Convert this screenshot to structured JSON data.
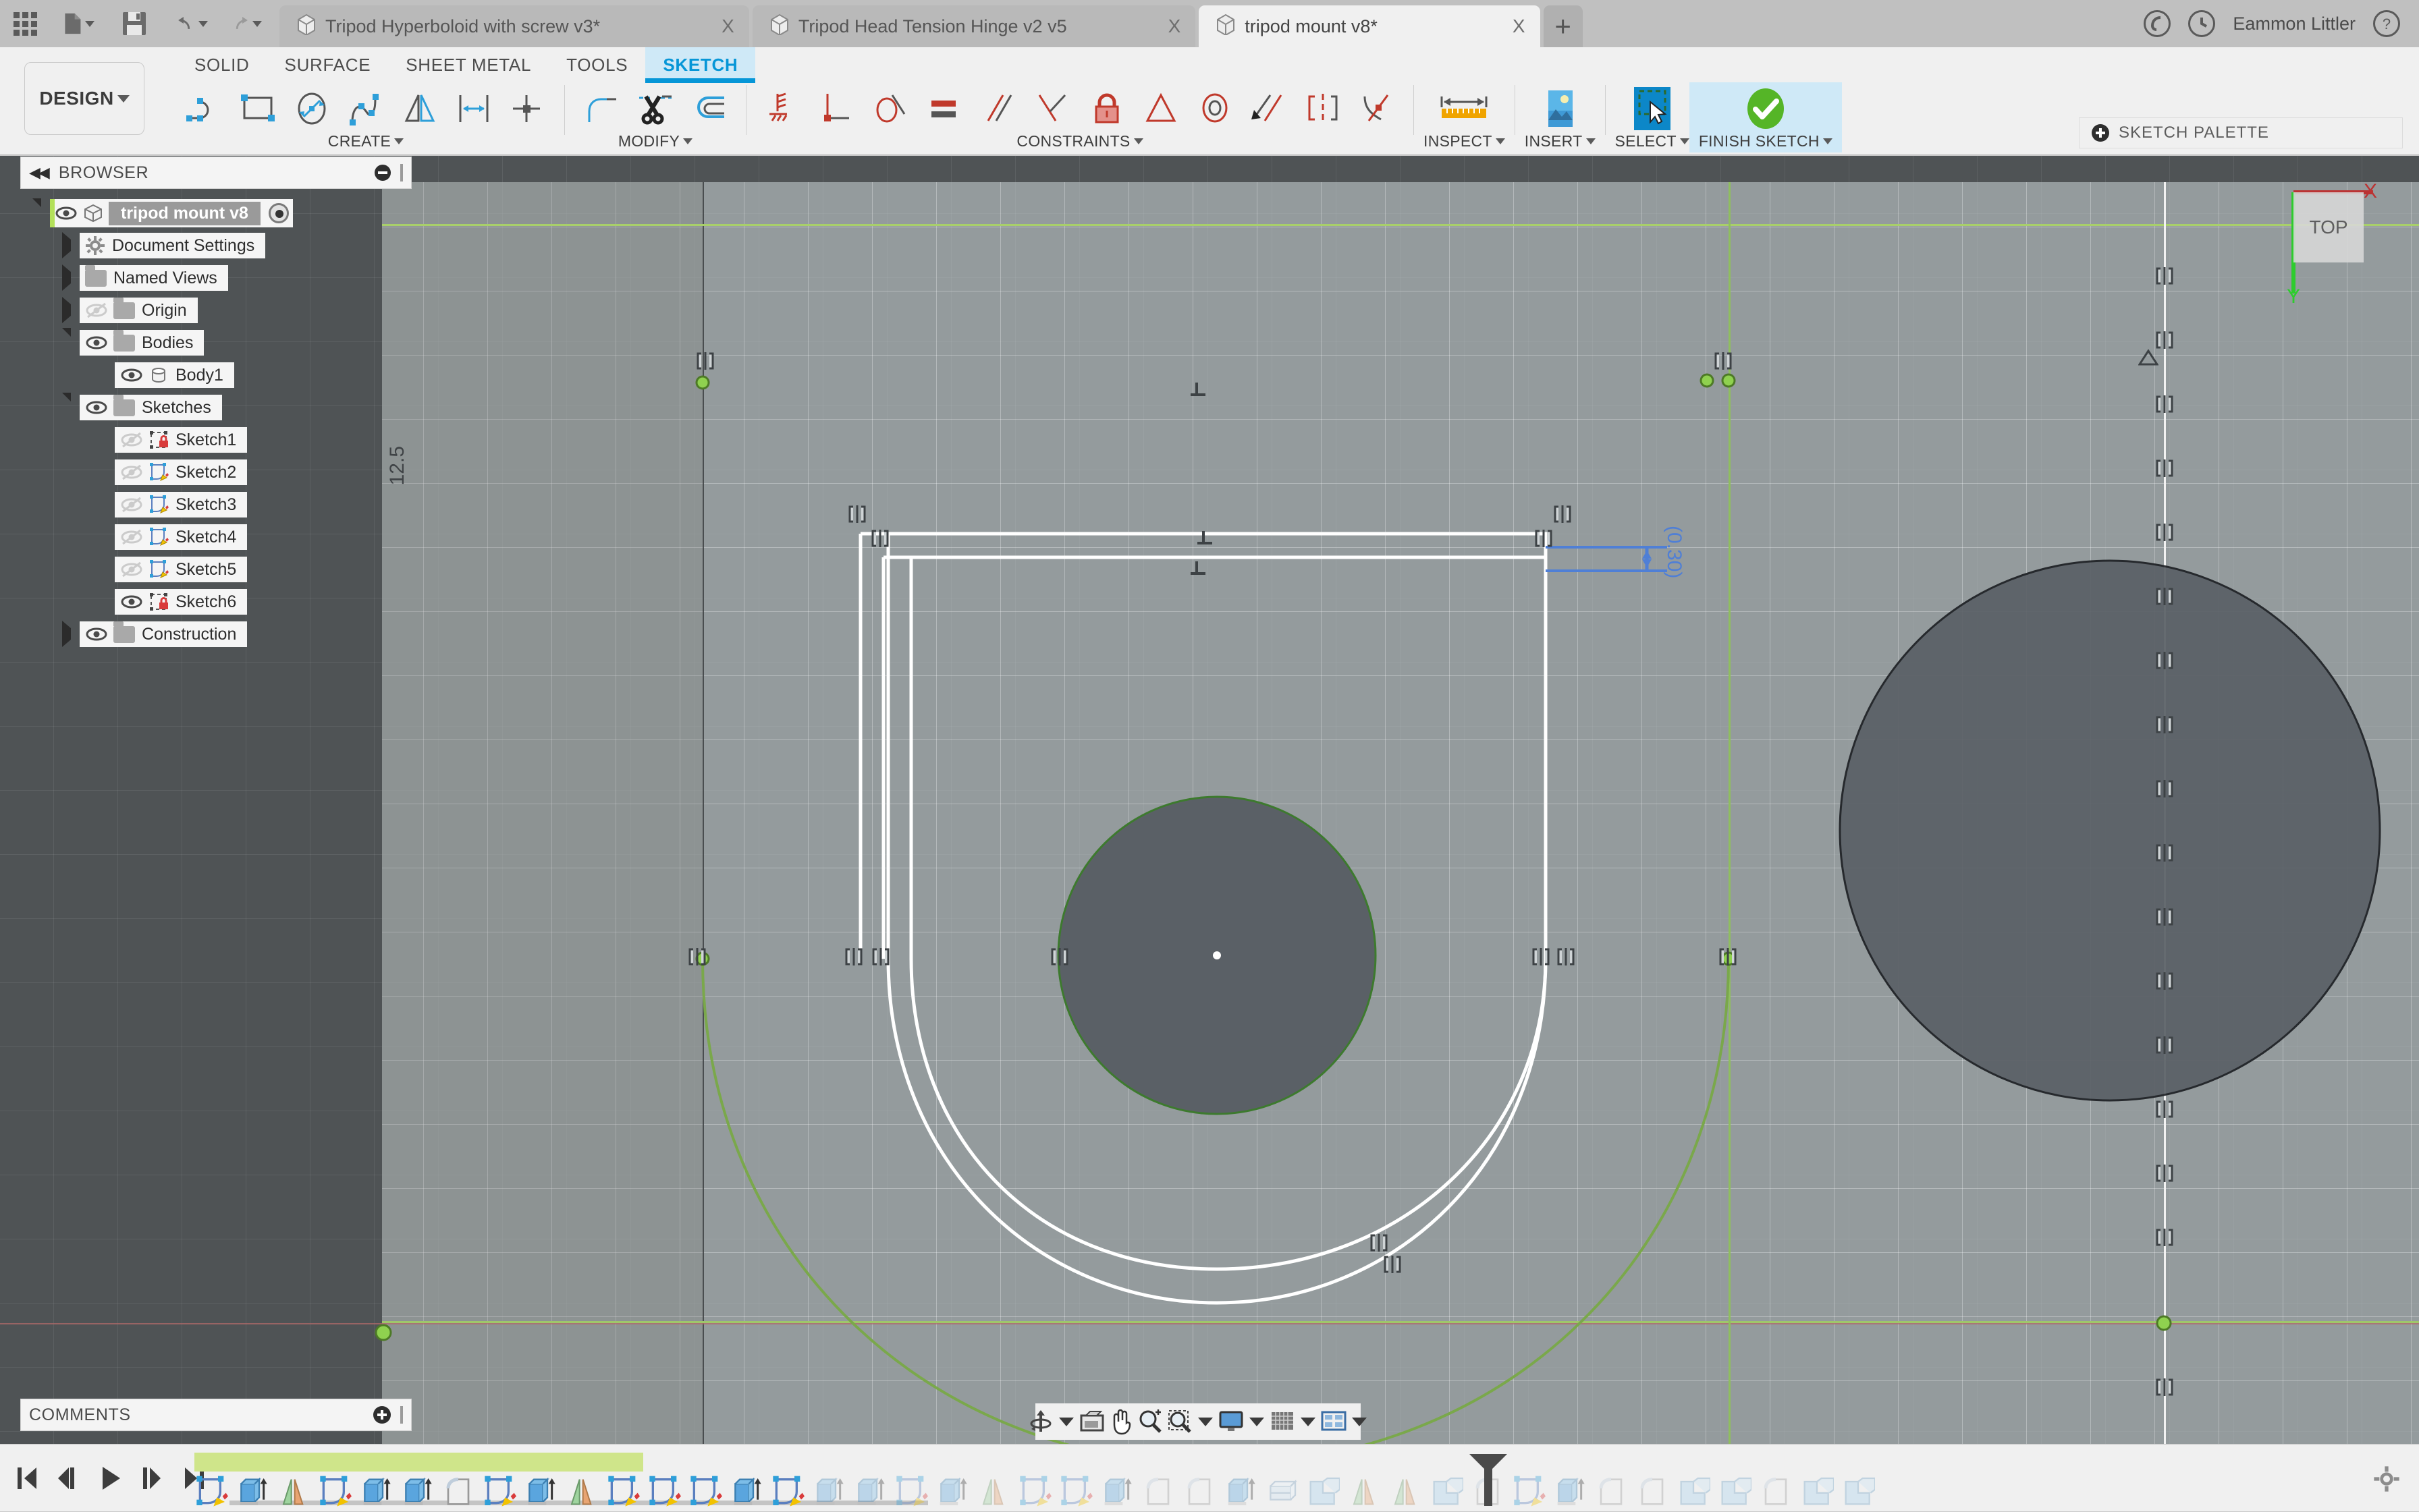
{
  "app": {
    "titlebar_icons": [
      "apps-grid-icon",
      "new-document-icon",
      "save-icon",
      "undo-icon",
      "redo-icon"
    ],
    "username": "Eammon Littler",
    "right_icons": [
      "job-status-icon",
      "recent-activity-icon",
      "help-icon"
    ],
    "new_tab_label": "+",
    "close_label": "X"
  },
  "tabs": [
    {
      "label": "Tripod Hyperboloid with screw v3*",
      "active": false
    },
    {
      "label": "Tripod Head Tension Hinge v2 v5",
      "active": false
    },
    {
      "label": "tripod mount v8*",
      "active": true
    }
  ],
  "ribbon": {
    "design_label": "DESIGN",
    "workspace_tabs": [
      {
        "label": "SOLID",
        "active": false
      },
      {
        "label": "SURFACE",
        "active": false
      },
      {
        "label": "SHEET METAL",
        "active": false
      },
      {
        "label": "TOOLS",
        "active": false
      },
      {
        "label": "SKETCH",
        "active": true
      }
    ],
    "groups": [
      {
        "label": "CREATE",
        "tools": [
          "line-icon",
          "rectangle-icon",
          "circle-icon",
          "spline-icon",
          "mirror-icon",
          "offset-dimension-icon",
          "point-icon"
        ]
      },
      {
        "label": "MODIFY",
        "tools": [
          "fillet-icon",
          "trim-scissors-icon",
          "offset-icon"
        ]
      },
      {
        "label": "CONSTRAINTS",
        "tools": [
          "horizontal-vertical-icon",
          "perpendicular-icon",
          "tangent-icon",
          "equal-icon",
          "parallel-icon",
          "collinear-icon",
          "fix-lock-icon",
          "midpoint-icon",
          "concentric-icon",
          "coincident-icon",
          "symmetry-icon",
          "curvature-icon"
        ]
      },
      {
        "label": "INSPECT",
        "tools": [
          "measure-ruler-icon"
        ]
      },
      {
        "label": "INSERT",
        "tools": [
          "insert-image-icon"
        ]
      },
      {
        "label": "SELECT",
        "tools": [
          "select-window-icon"
        ]
      },
      {
        "label": "FINISH SKETCH",
        "tools": [
          "green-check-icon"
        ]
      }
    ],
    "sketch_palette_label": "SKETCH PALETTE"
  },
  "browser": {
    "header": "BROWSER",
    "collapse_icon": "rewind-icon",
    "items": [
      {
        "label": "tripod mount v8",
        "indent": 0,
        "expanded": true,
        "visible": true,
        "icon": "component-cube-icon",
        "root": true
      },
      {
        "label": "Document Settings",
        "indent": 1,
        "expanded": false,
        "visible": null,
        "icon": "gear-icon"
      },
      {
        "label": "Named Views",
        "indent": 1,
        "expanded": false,
        "visible": null,
        "icon": "folder-icon"
      },
      {
        "label": "Origin",
        "indent": 1,
        "expanded": false,
        "visible": false,
        "icon": "folder-icon"
      },
      {
        "label": "Bodies",
        "indent": 1,
        "expanded": true,
        "visible": true,
        "icon": "folder-icon"
      },
      {
        "label": "Body1",
        "indent": 2,
        "expanded": null,
        "visible": true,
        "icon": "body-icon"
      },
      {
        "label": "Sketches",
        "indent": 1,
        "expanded": true,
        "visible": true,
        "icon": "folder-icon"
      },
      {
        "label": "Sketch1",
        "indent": 2,
        "expanded": null,
        "visible": false,
        "icon": "sketch-locked-icon"
      },
      {
        "label": "Sketch2",
        "indent": 2,
        "expanded": null,
        "visible": false,
        "icon": "sketch-edit-icon"
      },
      {
        "label": "Sketch3",
        "indent": 2,
        "expanded": null,
        "visible": false,
        "icon": "sketch-edit-icon"
      },
      {
        "label": "Sketch4",
        "indent": 2,
        "expanded": null,
        "visible": false,
        "icon": "sketch-edit-icon"
      },
      {
        "label": "Sketch5",
        "indent": 2,
        "expanded": null,
        "visible": false,
        "icon": "sketch-edit-icon"
      },
      {
        "label": "Sketch6",
        "indent": 2,
        "expanded": null,
        "visible": true,
        "icon": "sketch-locked-icon"
      },
      {
        "label": "Construction",
        "indent": 1,
        "expanded": false,
        "visible": true,
        "icon": "folder-icon"
      }
    ]
  },
  "canvas": {
    "dimension_label": "(0.30)",
    "axis_label": "12.5",
    "viewcube_face": "TOP",
    "axis_x_label": "X",
    "axis_y_label": "Y",
    "accent_green": "#8fbf5e",
    "accent_blue": "#4f7fd6",
    "sketch_line_color": "#ffffff"
  },
  "comments": {
    "header": "COMMENTS",
    "add_icon": "plus-circle-icon"
  },
  "navbar": {
    "items": [
      "orbit-icon",
      "look-at-icon",
      "pan-hand-icon",
      "zoom-in-icon",
      "zoom-window-icon",
      "display-settings-icon",
      "grid-snaps-icon",
      "viewports-icon"
    ]
  },
  "timeline": {
    "playback": [
      "go-to-beginning-icon",
      "step-back-icon",
      "play-icon",
      "step-forward-icon",
      "go-to-end-icon"
    ],
    "marker_icon": "timeline-marker-icon",
    "settings_icon": "gear-icon",
    "features": [
      {
        "icon": "sketch-icon",
        "state": "active"
      },
      {
        "icon": "extrude-icon",
        "state": "active"
      },
      {
        "icon": "mirror-icon",
        "state": "active"
      },
      {
        "icon": "sketch-icon",
        "state": "active"
      },
      {
        "icon": "extrude-icon",
        "state": "active"
      },
      {
        "icon": "extrude-icon",
        "state": "active"
      },
      {
        "icon": "fillet-icon",
        "state": "active"
      },
      {
        "icon": "sketch-icon",
        "state": "active"
      },
      {
        "icon": "extrude-icon",
        "state": "active"
      },
      {
        "icon": "mirror-icon",
        "state": "active"
      },
      {
        "icon": "sketch-icon",
        "state": "active"
      },
      {
        "icon": "sketch-icon",
        "state": "active"
      },
      {
        "icon": "sketch-icon",
        "state": "active"
      },
      {
        "icon": "extrude-icon",
        "state": "active"
      },
      {
        "icon": "sketch-icon",
        "state": "active"
      },
      {
        "icon": "extrude-icon",
        "state": "dim"
      },
      {
        "icon": "extrude-icon",
        "state": "dim"
      },
      {
        "icon": "sketch-icon",
        "state": "dim"
      },
      {
        "icon": "extrude-icon",
        "state": "dim"
      },
      {
        "icon": "mirror-icon",
        "state": "dim"
      },
      {
        "icon": "sketch-icon",
        "state": "dim"
      },
      {
        "icon": "sketch-icon",
        "state": "dim"
      },
      {
        "icon": "extrude-icon",
        "state": "dim"
      },
      {
        "icon": "fillet-icon",
        "state": "dim"
      },
      {
        "icon": "fillet-icon",
        "state": "dim"
      },
      {
        "icon": "extrude-icon",
        "state": "dim"
      },
      {
        "icon": "shell-icon",
        "state": "dim"
      },
      {
        "icon": "combine-icon",
        "state": "dim"
      },
      {
        "icon": "mirror-icon",
        "state": "dim"
      },
      {
        "icon": "mirror-icon",
        "state": "dim"
      },
      {
        "icon": "combine-icon",
        "state": "dim"
      },
      {
        "icon": "fillet-icon",
        "state": "dim"
      },
      {
        "icon": "sketch-icon",
        "state": "dim"
      },
      {
        "icon": "extrude-icon",
        "state": "dim"
      },
      {
        "icon": "fillet-icon",
        "state": "dim"
      },
      {
        "icon": "fillet-icon",
        "state": "dim"
      },
      {
        "icon": "combine-icon",
        "state": "dim"
      },
      {
        "icon": "combine-icon",
        "state": "dim"
      },
      {
        "icon": "fillet-icon",
        "state": "dim"
      },
      {
        "icon": "combine-icon",
        "state": "dim"
      },
      {
        "icon": "combine-icon",
        "state": "dim"
      }
    ]
  }
}
